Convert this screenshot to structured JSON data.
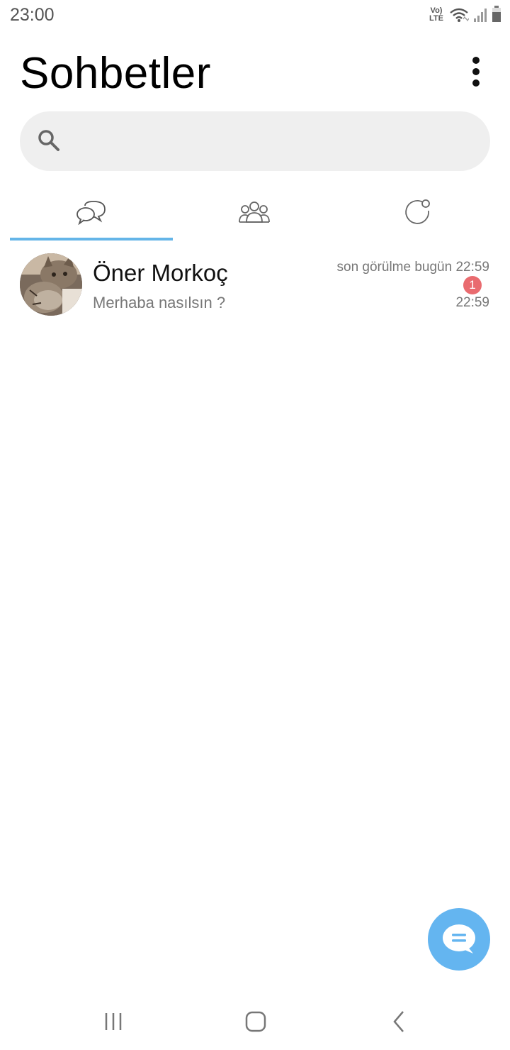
{
  "status_bar": {
    "time": "23:00",
    "volte_top": "Vo)",
    "volte_bottom": "LTE",
    "icons": [
      "volte-icon",
      "wifi-icon",
      "signal-icon",
      "battery-icon"
    ]
  },
  "header": {
    "title": "Sohbetler",
    "menu_icon": "more-vertical-icon"
  },
  "search": {
    "placeholder": "",
    "value": "",
    "icon": "search-icon"
  },
  "tabs": [
    {
      "icon": "chats-icon",
      "selected": true
    },
    {
      "icon": "groups-icon",
      "selected": false
    },
    {
      "icon": "status-icon",
      "selected": false
    }
  ],
  "chats": [
    {
      "name": "Öner Morkoç",
      "preview": "Merhaba nasılsın ?",
      "last_seen": "son görülme bugün 22:59",
      "unread": "1",
      "time": "22:59",
      "avatar": "cat-photo"
    }
  ],
  "fab": {
    "icon": "new-chat-icon"
  },
  "nav": {
    "icons": [
      "recents-icon",
      "home-icon",
      "back-icon"
    ]
  },
  "colors": {
    "accent": "#64b5e8",
    "fab": "#64b5f0",
    "badge": "#e96b6f",
    "search_bg": "#efefef",
    "secondary_text": "#777777"
  }
}
